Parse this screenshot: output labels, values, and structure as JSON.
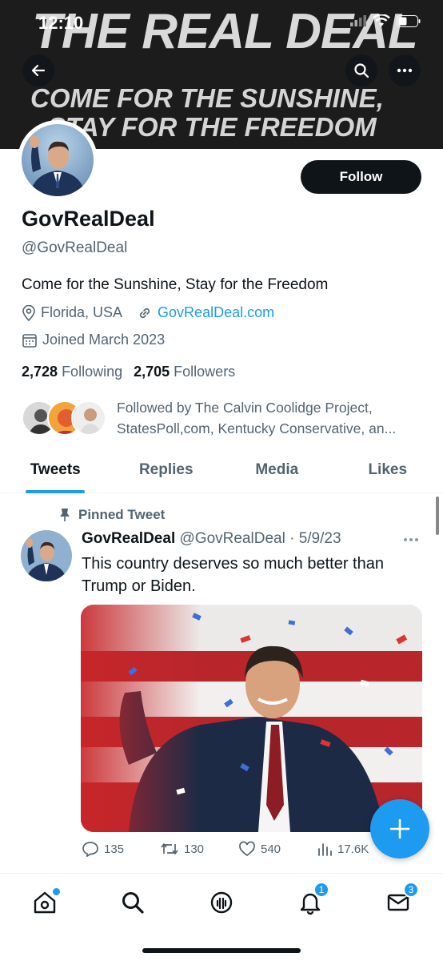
{
  "status_bar": {
    "time": "12:10"
  },
  "banner": {
    "big_text": "THE REAL DEAL",
    "line1": "COME FOR THE SUNSHINE,",
    "line2": "STAY FOR THE FREEDOM"
  },
  "profile": {
    "display_name": "GovRealDeal",
    "handle": "@GovRealDeal",
    "follow_label": "Follow",
    "bio": "Come for the Sunshine, Stay for the Freedom",
    "location": "Florida, USA",
    "website": "GovRealDeal.com",
    "joined": "Joined March 2023",
    "following_count": "2,728",
    "following_label": "Following",
    "followers_count": "2,705",
    "followers_label": "Followers",
    "followed_by": "Followed by The Calvin Coolidge Project, StatesPoll,com, Kentucky Conservative, an..."
  },
  "tabs": [
    {
      "label": "Tweets",
      "active": true
    },
    {
      "label": "Replies",
      "active": false
    },
    {
      "label": "Media",
      "active": false
    },
    {
      "label": "Likes",
      "active": false
    }
  ],
  "tweet": {
    "pinned_label": "Pinned Tweet",
    "author": "GovRealDeal",
    "handle": "@GovRealDeal",
    "date": "· 5/9/23",
    "text": "This country deserves so much better than Trump or Biden.",
    "replies": "135",
    "retweets": "130",
    "likes": "540",
    "views": "17.6K"
  },
  "bottom_nav": {
    "notifications_badge": "1",
    "messages_badge": "3"
  },
  "colors": {
    "accent": "#1d9bf0",
    "text": "#0f1419",
    "muted": "#536471"
  }
}
